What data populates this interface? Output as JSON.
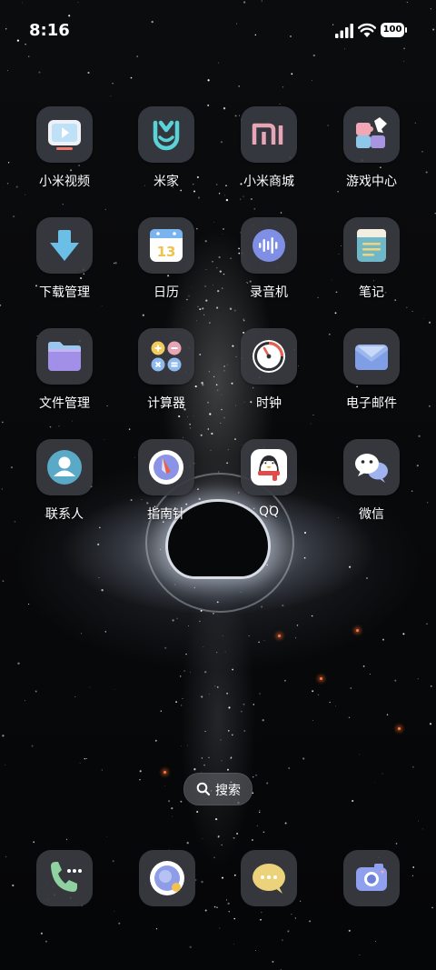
{
  "status_bar": {
    "time": "8:16",
    "battery_level": "100",
    "icons": [
      "signal-icon",
      "wifi-icon",
      "battery-icon"
    ]
  },
  "apps": [
    {
      "label": "小米视频",
      "icon": "video-player-icon"
    },
    {
      "label": "米家",
      "icon": "mijia-icon"
    },
    {
      "label": "小米商城",
      "icon": "mi-store-icon"
    },
    {
      "label": "游戏中心",
      "icon": "game-center-icon"
    },
    {
      "label": "下载管理",
      "icon": "download-arrow-icon"
    },
    {
      "label": "日历",
      "icon": "calendar-icon"
    },
    {
      "label": "录音机",
      "icon": "recorder-icon"
    },
    {
      "label": "笔记",
      "icon": "notes-icon"
    },
    {
      "label": "文件管理",
      "icon": "folder-icon"
    },
    {
      "label": "计算器",
      "icon": "calculator-icon"
    },
    {
      "label": "时钟",
      "icon": "clock-icon"
    },
    {
      "label": "电子邮件",
      "icon": "mail-icon"
    },
    {
      "label": "联系人",
      "icon": "contacts-icon"
    },
    {
      "label": "指南针",
      "icon": "compass-icon"
    },
    {
      "label": "QQ",
      "icon": "qq-penguin-icon"
    },
    {
      "label": "微信",
      "icon": "wechat-icon"
    }
  ],
  "calendar_day": "13",
  "search": {
    "label": "搜索"
  },
  "dock": [
    {
      "icon": "phone-icon"
    },
    {
      "icon": "browser-icon"
    },
    {
      "icon": "messages-icon"
    },
    {
      "icon": "camera-icon"
    }
  ],
  "colors": {
    "icon_bg": "#3a3c42",
    "accent_blue": "#5ab4e6",
    "accent_purple": "#8a8fe0",
    "accent_pink": "#e7a6b6"
  }
}
